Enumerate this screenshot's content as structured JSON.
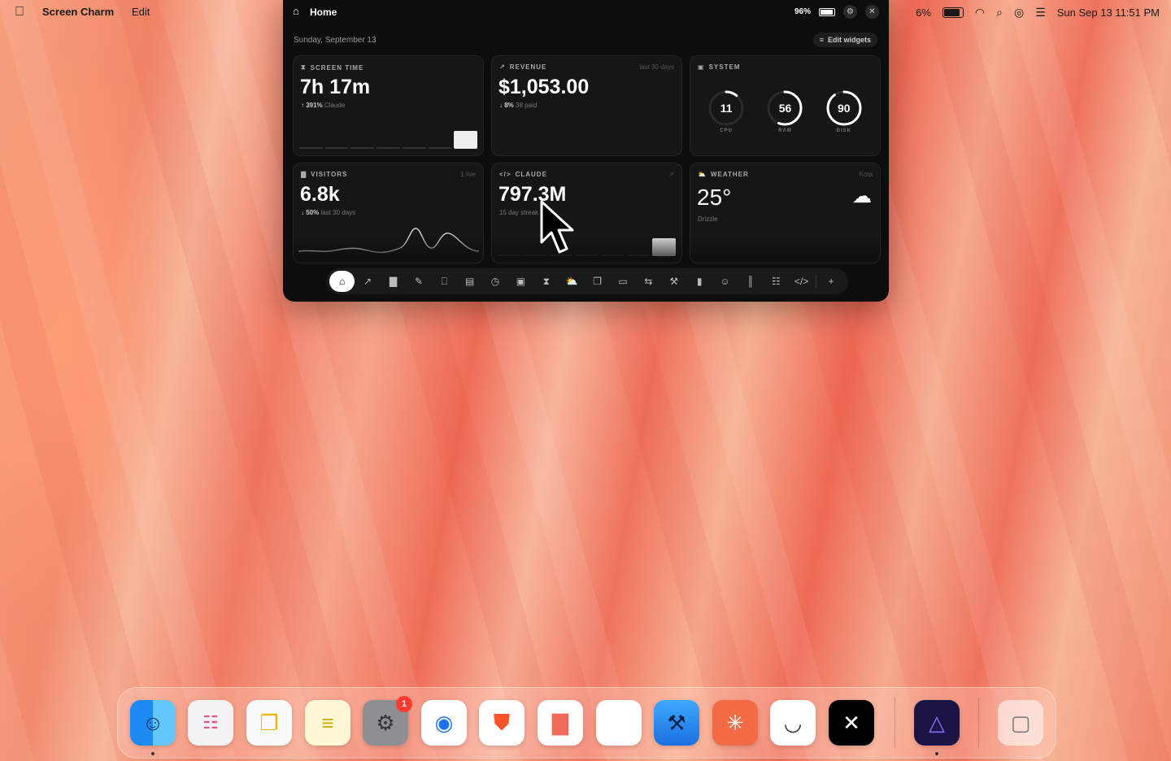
{
  "menubar": {
    "apple_icon": "apple-logo-icon",
    "app_name": "Screen Charm",
    "menu_edit": "Edit",
    "battery_percent": "6%",
    "datetime": "Sun Sep 13  11:51 PM"
  },
  "panel": {
    "title": "Home",
    "battery": "96%",
    "date": "Sunday, September 13",
    "edit_widgets": "Edit widgets",
    "screen_time": {
      "label": "SCREEN TIME",
      "value": "7h 17m",
      "change": "391%",
      "note": "Claude"
    },
    "revenue": {
      "label": "REVENUE",
      "corner": "last 30 days",
      "value": "$1,053.00",
      "change": "8%",
      "note": "38 paid"
    },
    "system": {
      "label": "SYSTEM",
      "gauges": [
        {
          "value": "11",
          "label": "CPU",
          "fraction": 0.11
        },
        {
          "value": "56",
          "label": "RAM",
          "fraction": 0.56
        },
        {
          "value": "90",
          "label": "DISK",
          "fraction": 0.9
        }
      ]
    },
    "visitors": {
      "label": "VISITORS",
      "corner": "1 live",
      "value": "6.8k",
      "change": "50%",
      "note": "last 30 days"
    },
    "claude": {
      "label": "CLAUDE",
      "value": "797.3M",
      "note": "15 day streak"
    },
    "weather": {
      "label": "WEATHER",
      "corner": "Kota",
      "value": "25°",
      "note": "Drizzle"
    }
  },
  "accent": "#ffffff",
  "dock_badge": "1"
}
